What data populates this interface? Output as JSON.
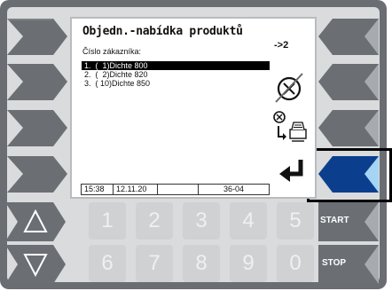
{
  "screen": {
    "title": "Objedn.-nabídka produktů",
    "step": "->2",
    "field_label": "Číslo zákazníka:",
    "items": [
      "1.  (  1)Dichte 800",
      "2.  (  2)Dichte 820",
      "3.  ( 10)Dichte 850"
    ],
    "status": {
      "time": "15:38",
      "date": "12.11.20",
      "empty": "",
      "code": "36-04"
    }
  },
  "keypad": {
    "row1": [
      "1",
      "2",
      "3",
      "4",
      "5"
    ],
    "row2": [
      "6",
      "7",
      "8",
      "9",
      "0"
    ]
  },
  "right_buttons": {
    "start_label": "START",
    "stop_label": "STOP"
  },
  "colors": {
    "softkey": "#6b6e73",
    "softkey_active": "#0b3f8e",
    "softkey_active_light": "#a6d4f4",
    "panel": "#d9dbdc"
  },
  "icons": {
    "cancel": "circle-cross-icon",
    "print": "print-cancel-icon",
    "enter": "enter-arrow-icon",
    "up": "triangle-up-icon",
    "down": "triangle-down-icon"
  }
}
